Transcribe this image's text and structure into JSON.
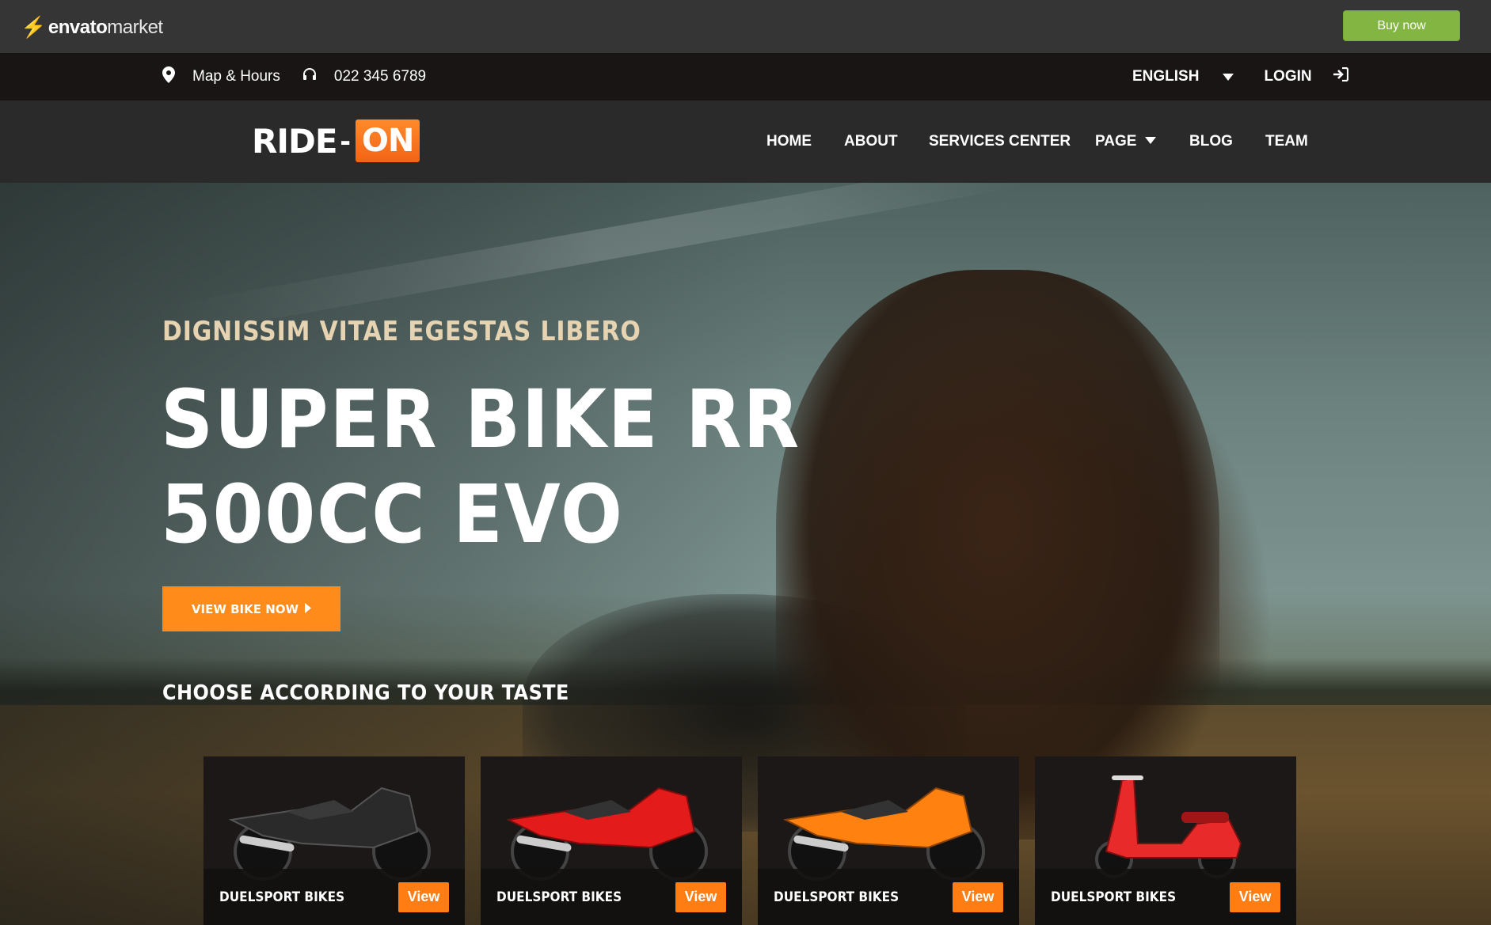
{
  "envato_bar": {
    "logo_brand": "envato",
    "logo_suffix": "market",
    "buy_label": "Buy now",
    "accent_color": "#82b541"
  },
  "info_bar": {
    "map_label": "Map & Hours",
    "phone": "022 345 6789",
    "language": "ENGLISH",
    "login_label": "LOGIN",
    "icons": [
      "map-pin-icon",
      "headphones-icon",
      "chevron-down-icon",
      "sign-in-icon"
    ]
  },
  "nav": {
    "logo_ride": "RIDE",
    "logo_dash": "-",
    "logo_on": "ON",
    "items": [
      {
        "label": "HOME"
      },
      {
        "label": "ABOUT"
      },
      {
        "label": "SERVICES CENTER"
      },
      {
        "label": "PAGE",
        "has_dropdown": true
      },
      {
        "label": "BLOG"
      },
      {
        "label": "TEAM"
      }
    ]
  },
  "hero": {
    "subtitle": "DIGNISSIM VITAE EGESTAS LIBERO",
    "title_line1": "SUPER BIKE RR",
    "title_line2": "500CC EVO",
    "cta_label": "VIEW BIKE NOW",
    "section_title": "CHOOSE ACCORDING TO YOUR TASTE",
    "accent_color": "#ff8c1a"
  },
  "cards": [
    {
      "title": "DUELSPORT BIKES",
      "button": "View",
      "bike_color": "#2a2a2a",
      "type": "sport-bike"
    },
    {
      "title": "DUELSPORT BIKES",
      "button": "View",
      "bike_color": "#e31b1b",
      "type": "sport-bike"
    },
    {
      "title": "DUELSPORT BIKES",
      "button": "View",
      "bike_color": "#ff8210",
      "type": "sport-bike"
    },
    {
      "title": "DUELSPORT BIKES",
      "button": "View",
      "bike_color": "#e82a2a",
      "type": "scooter"
    }
  ]
}
